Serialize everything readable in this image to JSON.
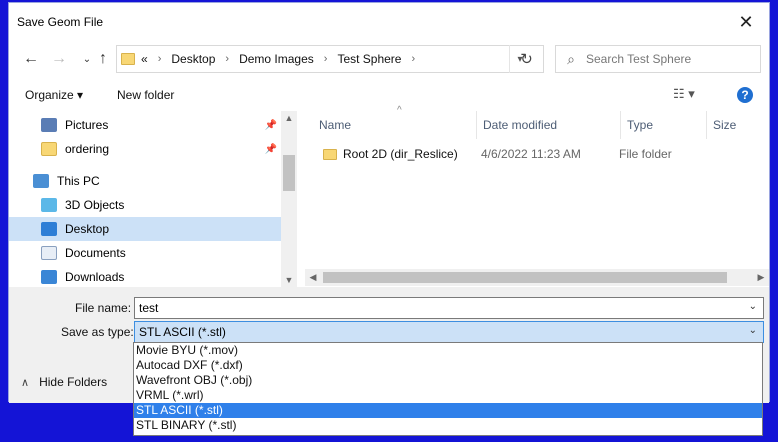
{
  "window": {
    "title": "Save Geom File"
  },
  "address_bar": {
    "crumbs": [
      "Desktop",
      "Demo Images",
      "Test Sphere"
    ],
    "prefix": "«"
  },
  "search": {
    "placeholder": "Search Test Sphere"
  },
  "toolbar": {
    "organize": "Organize ▾",
    "new_folder": "New folder"
  },
  "sidebar": {
    "items": [
      {
        "label": "Pictures"
      },
      {
        "label": "ordering"
      },
      {
        "label": "This PC"
      },
      {
        "label": "3D Objects"
      },
      {
        "label": "Desktop"
      },
      {
        "label": "Documents"
      },
      {
        "label": "Downloads"
      }
    ]
  },
  "file_list": {
    "columns": [
      "Name",
      "Date modified",
      "Type",
      "Size"
    ],
    "rows": [
      {
        "name": "Root 2D (dir_Reslice)",
        "date": "4/6/2022 11:23 AM",
        "type": "File folder"
      }
    ]
  },
  "form": {
    "file_name_label": "File name:",
    "file_name_value": "test",
    "save_type_label": "Save as type:",
    "save_type_value": "STL ASCII (*.stl)"
  },
  "hide_folders": {
    "label": "Hide Folders"
  },
  "dropdown": {
    "options": [
      {
        "label": "Movie BYU (*.mov)"
      },
      {
        "label": "Autocad DXF (*.dxf)"
      },
      {
        "label": "Wavefront OBJ (*.obj)"
      },
      {
        "label": "VRML (*.wrl)"
      },
      {
        "label": "STL ASCII (*.stl)"
      },
      {
        "label": "STL BINARY (*.stl)"
      }
    ],
    "selected_index": 4
  },
  "colors": {
    "accent": "#2f80ea",
    "selection": "#cce1f7",
    "border_bg": "#1414d6"
  }
}
